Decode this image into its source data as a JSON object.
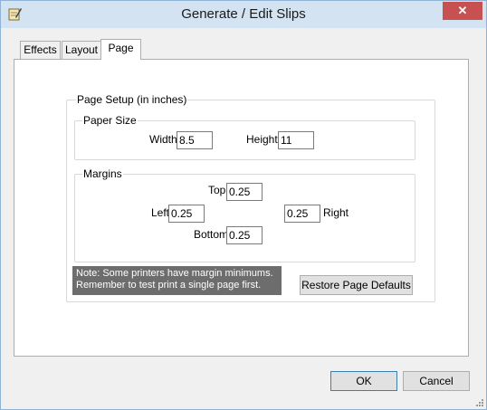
{
  "window": {
    "title": "Generate / Edit Slips",
    "close_glyph": "✕"
  },
  "tabs": [
    {
      "label": "Effects"
    },
    {
      "label": "Layout"
    },
    {
      "label": "Page"
    }
  ],
  "page_setup": {
    "label": "Page Setup (in inches)",
    "paper_size": {
      "label": "Paper Size",
      "width_label": "Width",
      "width_value": "8.5",
      "height_label": "Height",
      "height_value": "11"
    },
    "margins": {
      "label": "Margins",
      "top_label": "Top",
      "top_value": "0.25",
      "left_label": "Left",
      "left_value": "0.25",
      "right_label": "Right",
      "right_value": "0.25",
      "bottom_label": "Bottom",
      "bottom_value": "0.25"
    },
    "note": "Note: Some printers have margin minimums. Remember to test print a single page first.",
    "restore_button": "Restore Page Defaults"
  },
  "footer": {
    "ok": "OK",
    "cancel": "Cancel"
  }
}
